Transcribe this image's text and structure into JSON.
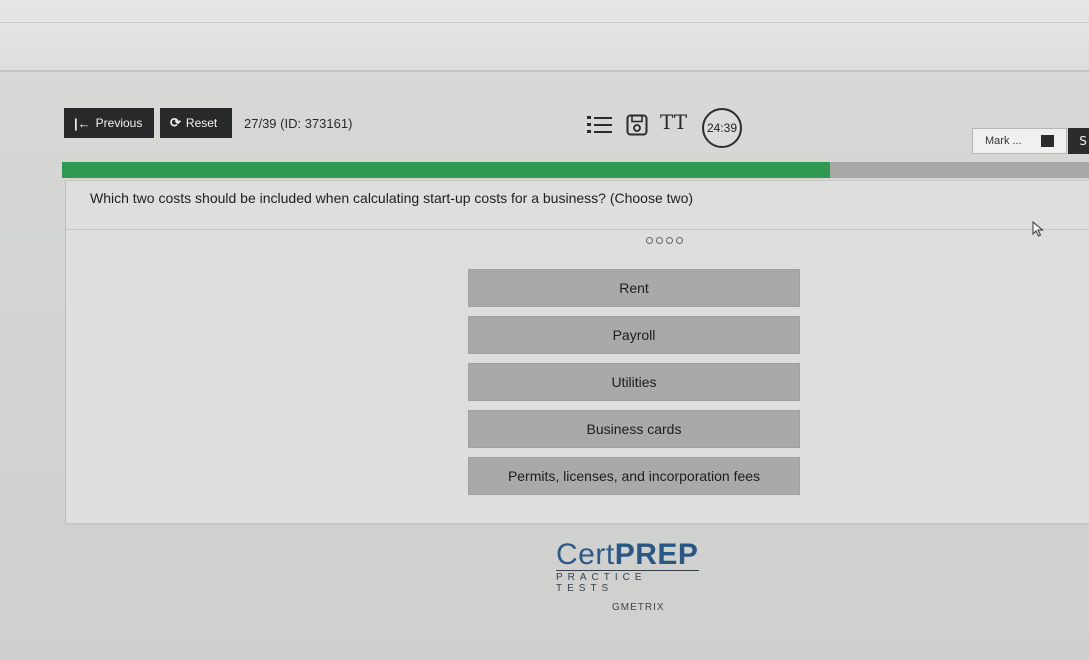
{
  "toolbar": {
    "previous_label": "Previous",
    "previous_icon": "first-arrow-icon",
    "reset_label": "Reset",
    "reset_icon": "refresh-icon",
    "question_counter": "27/39 (ID: 373161)",
    "timer": "24:39",
    "mark_label": "Mark ...",
    "next_partial": "S"
  },
  "progress": {
    "fraction": 0.748,
    "fill_color": "#2f9a4f",
    "track_color": "#a7a9a7"
  },
  "question": {
    "text": "Which two costs should be included when calculating start-up costs for a business? (Choose two)"
  },
  "options": [
    {
      "label": "Rent"
    },
    {
      "label": "Payroll"
    },
    {
      "label": "Utilities"
    },
    {
      "label": "Business cards"
    },
    {
      "label": "Permits, licenses, and incorporation fees"
    }
  ],
  "branding": {
    "logo_light": "Cert",
    "logo_bold": "PREP",
    "tagline": "PRACTICE TESTS",
    "vendor": "GMETRIX"
  }
}
